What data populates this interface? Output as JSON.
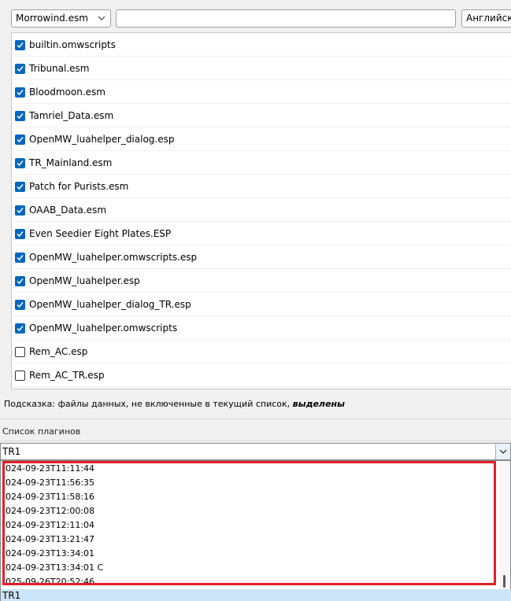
{
  "toolbar": {
    "game_file": "Morrowind.esm",
    "search_value": "",
    "language": "Английски"
  },
  "content_files": [
    {
      "name": "builtin.omwscripts",
      "checked": true
    },
    {
      "name": "Tribunal.esm",
      "checked": true
    },
    {
      "name": "Bloodmoon.esm",
      "checked": true
    },
    {
      "name": "Tamriel_Data.esm",
      "checked": true
    },
    {
      "name": "OpenMW_luahelper_dialog.esp",
      "checked": true
    },
    {
      "name": "TR_Mainland.esm",
      "checked": true
    },
    {
      "name": "Patch for Purists.esm",
      "checked": true
    },
    {
      "name": "OAAB_Data.esm",
      "checked": true
    },
    {
      "name": "Even Seedier Eight Plates.ESP",
      "checked": true
    },
    {
      "name": "OpenMW_luahelper.omwscripts.esp",
      "checked": true
    },
    {
      "name": "OpenMW_luahelper.esp",
      "checked": true
    },
    {
      "name": "OpenMW_luahelper_dialog_TR.esp",
      "checked": true
    },
    {
      "name": "OpenMW_luahelper.omwscripts",
      "checked": true
    },
    {
      "name": "Rem_AC.esp",
      "checked": false
    },
    {
      "name": "Rem_AC_TR.esp",
      "checked": false
    }
  ],
  "hint": {
    "text": "Подсказка: файлы данных, не включенные в текущий список, ",
    "emphasis": "выделены"
  },
  "plugin_list": {
    "label": "Список плагинов",
    "current": "TR1",
    "options": [
      "024-09-23T11:11:44",
      "024-09-23T11:56:35",
      "024-09-23T11:58:16",
      "024-09-23T12:00:08",
      "024-09-23T12:11:04",
      "024-09-23T13:21:47",
      "024-09-23T13:34:01",
      "024-09-23T13:34:01 C",
      "025-09-26T20:52:46"
    ],
    "selected_option": "TR1"
  },
  "colors": {
    "checkbox_on": "#0067c0",
    "highlight": "#e0202a",
    "selected_bg": "#cce4f7"
  }
}
